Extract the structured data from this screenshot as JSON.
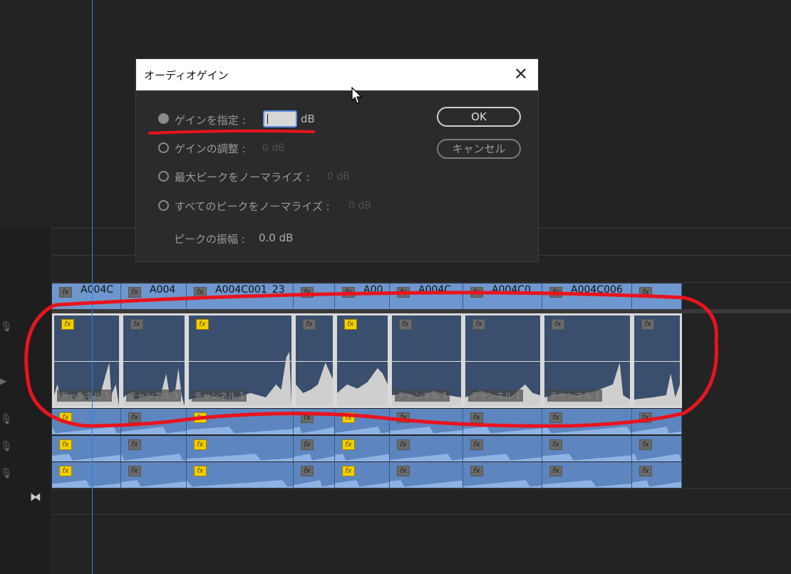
{
  "dialog": {
    "title": "オーディオゲイン",
    "close_symbol": "✕",
    "options": [
      {
        "label": "ゲインを指定 :",
        "value": "",
        "unit": "dB",
        "selected": true
      },
      {
        "label": "ゲインの調整 :",
        "value": "0 dB",
        "selected": false
      },
      {
        "label": "最大ピークをノーマライズ :",
        "value": "0 dB",
        "selected": false
      },
      {
        "label": "すべてのピークをノーマライズ :",
        "value": "0 dB",
        "selected": false
      }
    ],
    "peak_label": "ピークの振幅 :",
    "peak_value": "0.0 dB",
    "ok_label": "OK",
    "cancel_label": "キャンセル"
  },
  "timeline": {
    "video_clips": [
      "A004C",
      "A004",
      "A004C001_23",
      "",
      "A00",
      "A004C",
      "A004C0",
      "A004C006",
      ""
    ],
    "selected_track_channel_label": "チャンネル 1",
    "fx_label": "fx"
  },
  "colors": {
    "clip_blue": "#6f97cf",
    "selected_clip": "#3a4e6d",
    "fx_yellow": "#f0d000",
    "playhead": "#2f7fe0",
    "annotation_red": "#e8141e"
  },
  "icons": [
    "mic-icon",
    "play-icon",
    "sync-icon",
    "close-icon",
    "mouse-cursor-icon"
  ]
}
